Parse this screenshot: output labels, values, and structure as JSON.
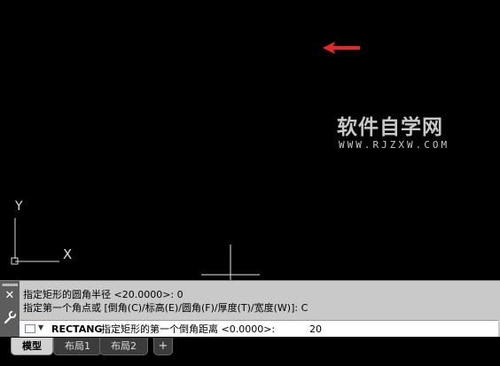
{
  "watermark": {
    "title": "软件自学网",
    "url": "WWW.RJZXW.COM"
  },
  "ucs": {
    "y_label": "Y",
    "x_label": "X"
  },
  "command_window": {
    "history": [
      "指定矩形的圆角半径 <20.0000>: 0",
      "指定第一个角点或 [倒角(C)/标高(E)/圆角(F)/厚度(T)/宽度(W)]: C"
    ],
    "current": {
      "command_name": "RECTANG",
      "prompt": "指定矩形的第一个倒角距离 <0.0000>:",
      "value": "20"
    },
    "close_symbol": "✕"
  },
  "tabs": {
    "items": [
      {
        "label": "模型",
        "active": true
      },
      {
        "label": "布局1",
        "active": false
      },
      {
        "label": "布局2",
        "active": false
      }
    ],
    "add_label": "+"
  },
  "colors": {
    "background": "#000000",
    "arrow": "#e8262a",
    "watermark": "#c8c8c8"
  },
  "icons": [
    "close-icon",
    "wrench-icon",
    "rectangle-command-icon",
    "chevron-down-icon",
    "annotation-arrow-icon"
  ]
}
